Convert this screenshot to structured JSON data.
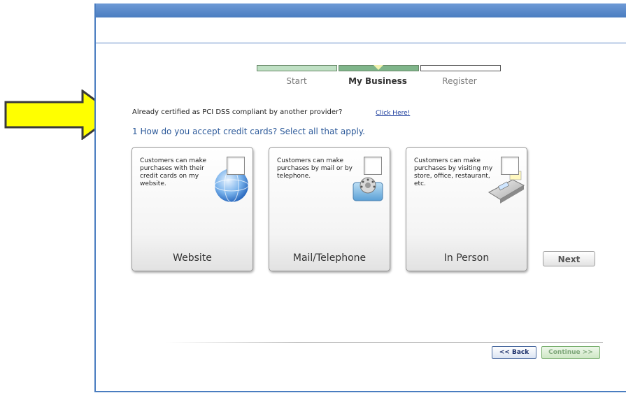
{
  "progress": {
    "steps": [
      {
        "label": "Start",
        "state": "done"
      },
      {
        "label": "My Business",
        "state": "current"
      },
      {
        "label": "Register",
        "state": "pending"
      }
    ]
  },
  "pci": {
    "text": "Already certified as PCI DSS compliant by another provider?",
    "link": "Click Here!"
  },
  "question": "1 How do you accept credit cards?  Select all that apply.",
  "options": [
    {
      "title": "Website",
      "description": "Customers can make purchases with their credit cards on my website.",
      "icon": "globe-icon",
      "checked": false
    },
    {
      "title": "Mail/Telephone",
      "description": "Customers can make purchases by mail or by telephone.",
      "icon": "telephone-icon",
      "checked": false
    },
    {
      "title": "In Person",
      "description": "Customers can make purchases by visiting my store, office, restaurant, etc.",
      "icon": "card-terminal-icon",
      "checked": false
    }
  ],
  "buttons": {
    "next": "Next",
    "back": "<< Back",
    "continue": "Continue >>"
  },
  "colors": {
    "accent_blue": "#4a7dc0",
    "progress_done": "#bfe0c4",
    "progress_current": "#7fb58a",
    "question_text": "#2d5a9a",
    "arrow_fill": "#ffff00"
  }
}
